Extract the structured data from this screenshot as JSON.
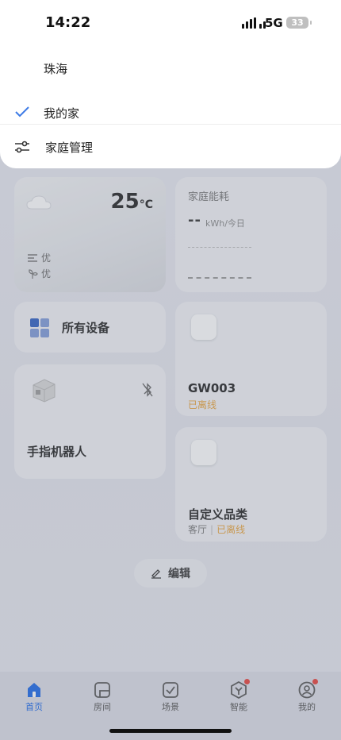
{
  "status_bar": {
    "time": "14:22",
    "network": "5G",
    "battery": "33"
  },
  "home_menu": {
    "city": "珠海",
    "current_home": "我的家",
    "manage_label": "家庭管理"
  },
  "weather": {
    "temperature": "25",
    "unit": "°C",
    "air_quality": "优",
    "wind": "优"
  },
  "energy": {
    "title": "家庭能耗",
    "value": "--",
    "unit": "kWh/今日"
  },
  "all_devices_label": "所有设备",
  "devices": [
    {
      "name": "手指机器人"
    },
    {
      "name": "GW003",
      "status": "已离线"
    },
    {
      "name": "自定义品类",
      "room": "客厅",
      "status": "已离线"
    }
  ],
  "edit_label": "编辑",
  "tabs": [
    {
      "label": "首页",
      "icon": "home-icon",
      "active": true
    },
    {
      "label": "房间",
      "icon": "room-icon"
    },
    {
      "label": "场景",
      "icon": "scene-icon"
    },
    {
      "label": "智能",
      "icon": "smart-icon",
      "badge": true
    },
    {
      "label": "我的",
      "icon": "profile-icon",
      "badge": true
    }
  ],
  "colors": {
    "accent": "#1a67e8",
    "offline": "#e8a33a",
    "badge": "#e8403a"
  }
}
